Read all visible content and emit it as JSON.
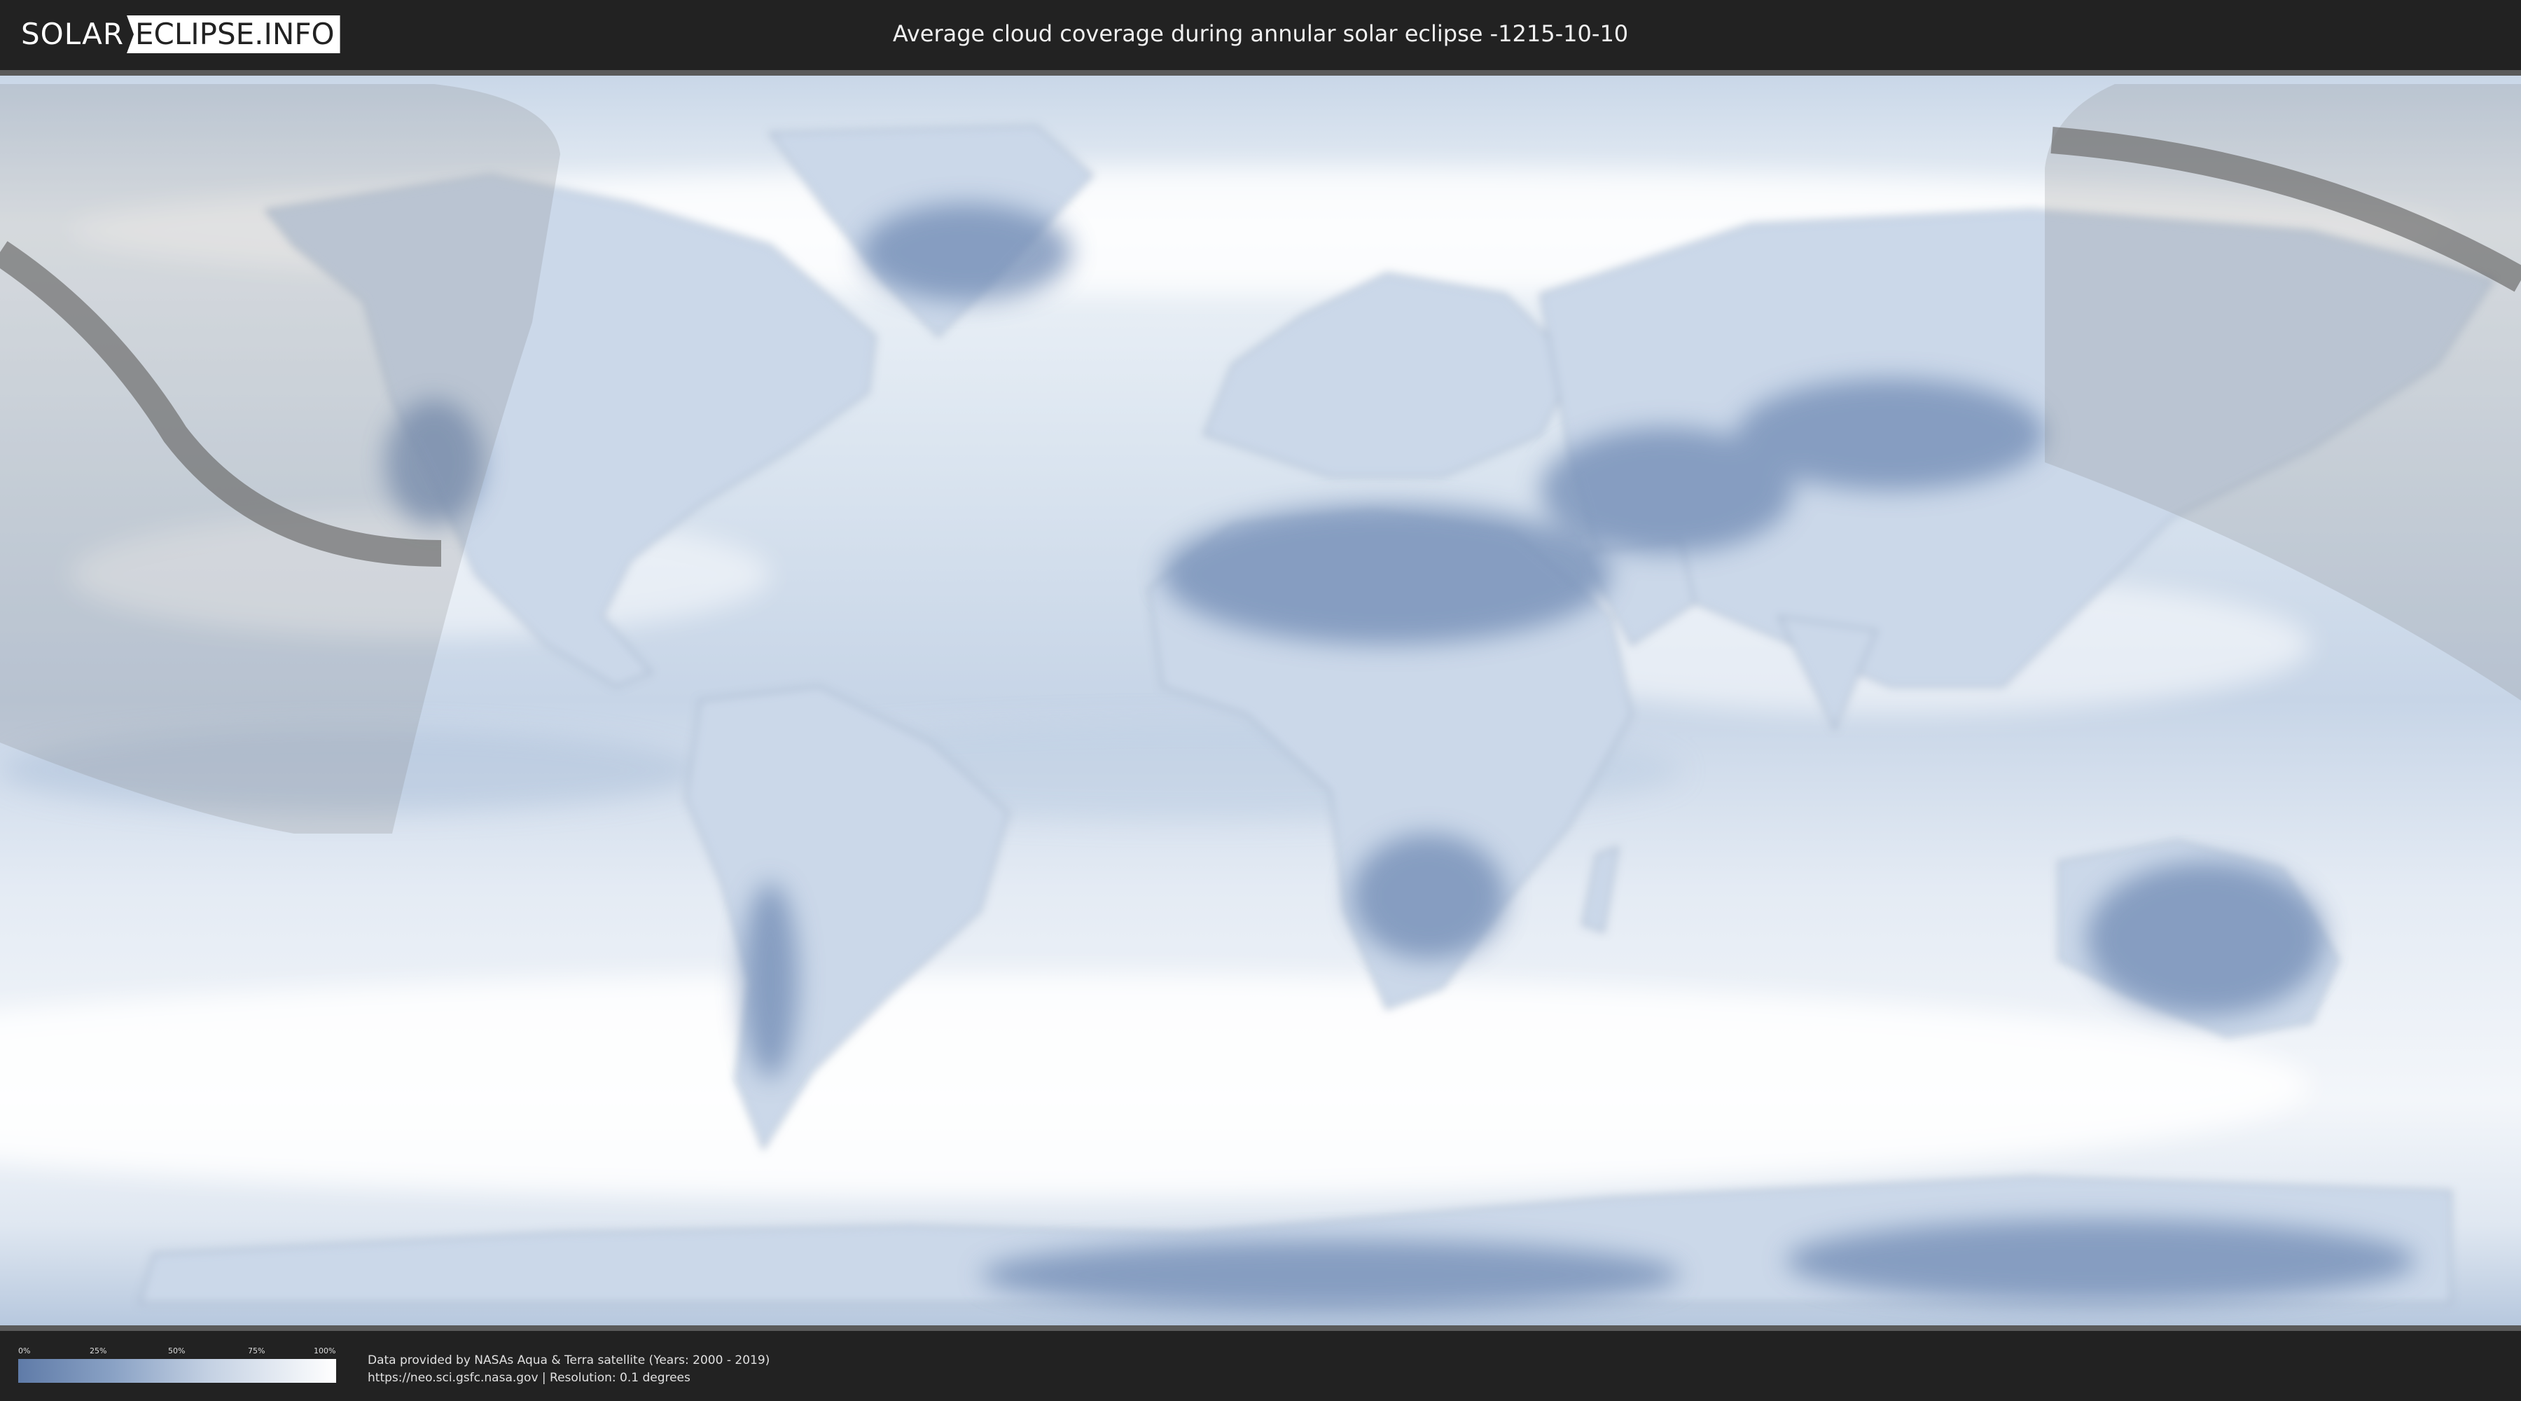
{
  "header": {
    "logo_left": "SOLAR",
    "logo_right": "ECLIPSE.INFO",
    "title": "Average cloud coverage during annular solar eclipse -1215-10-10"
  },
  "legend": {
    "ticks": [
      "0%",
      "25%",
      "50%",
      "75%",
      "100%"
    ],
    "tick_values": [
      0,
      25,
      50,
      75,
      100
    ],
    "color_low": "#5f7ba8",
    "color_high": "#ffffff"
  },
  "footer": {
    "credit_line1": "Data provided by NASAs Aqua & Terra satellite (Years: 2000 - 2019)",
    "credit_line2": "https://neo.sci.gsfc.nasa.gov | Resolution: 0.1 degrees"
  },
  "map": {
    "projection": "equirectangular",
    "ocean_color": "#dfe8f2",
    "land_clear_color": "#6f8ab4",
    "cloud_color": "#ffffff",
    "eclipse_shadow_color": "#808080",
    "path_color": "#6e6e6e"
  }
}
